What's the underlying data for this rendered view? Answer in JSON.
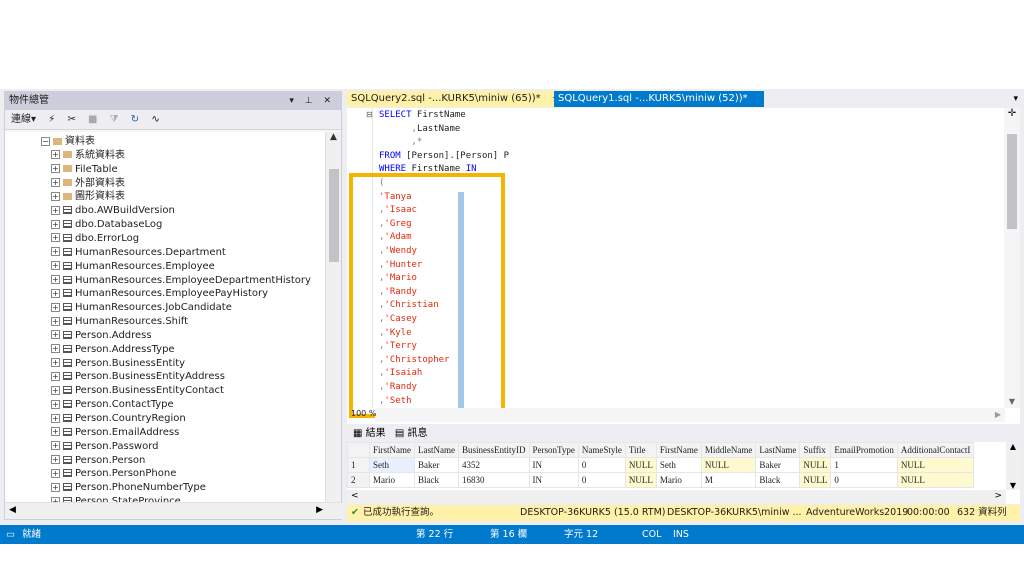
{
  "object_explorer": {
    "title": "物件總管",
    "controls": "▾ ⊥ ✕",
    "toolbar": {
      "connect": "連線▾",
      "icons": [
        "plug-icon",
        "disconnect-icon",
        "stop-icon",
        "filter-icon",
        "refresh-icon",
        "activity-icon"
      ]
    },
    "tree": [
      {
        "label": "資料表",
        "icon": "folder",
        "expand": "−"
      },
      {
        "label": "系統資料表",
        "icon": "folder",
        "expand": "+"
      },
      {
        "label": "FileTable",
        "icon": "folder",
        "expand": "+"
      },
      {
        "label": "外部資料表",
        "icon": "folder",
        "expand": "+"
      },
      {
        "label": "圖形資料表",
        "icon": "folder",
        "expand": "+"
      },
      {
        "label": "dbo.AWBuildVersion",
        "icon": "table",
        "expand": "+"
      },
      {
        "label": "dbo.DatabaseLog",
        "icon": "table",
        "expand": "+"
      },
      {
        "label": "dbo.ErrorLog",
        "icon": "table",
        "expand": "+"
      },
      {
        "label": "HumanResources.Department",
        "icon": "table",
        "expand": "+"
      },
      {
        "label": "HumanResources.Employee",
        "icon": "table",
        "expand": "+"
      },
      {
        "label": "HumanResources.EmployeeDepartmentHistory",
        "icon": "table",
        "expand": "+"
      },
      {
        "label": "HumanResources.EmployeePayHistory",
        "icon": "table",
        "expand": "+"
      },
      {
        "label": "HumanResources.JobCandidate",
        "icon": "table",
        "expand": "+"
      },
      {
        "label": "HumanResources.Shift",
        "icon": "table",
        "expand": "+"
      },
      {
        "label": "Person.Address",
        "icon": "table",
        "expand": "+"
      },
      {
        "label": "Person.AddressType",
        "icon": "table",
        "expand": "+"
      },
      {
        "label": "Person.BusinessEntity",
        "icon": "table",
        "expand": "+"
      },
      {
        "label": "Person.BusinessEntityAddress",
        "icon": "table",
        "expand": "+"
      },
      {
        "label": "Person.BusinessEntityContact",
        "icon": "table",
        "expand": "+"
      },
      {
        "label": "Person.ContactType",
        "icon": "table",
        "expand": "+"
      },
      {
        "label": "Person.CountryRegion",
        "icon": "table",
        "expand": "+"
      },
      {
        "label": "Person.EmailAddress",
        "icon": "table",
        "expand": "+"
      },
      {
        "label": "Person.Password",
        "icon": "table",
        "expand": "+"
      },
      {
        "label": "Person.Person",
        "icon": "table",
        "expand": "+"
      },
      {
        "label": "Person.PersonPhone",
        "icon": "table",
        "expand": "+"
      },
      {
        "label": "Person.PhoneNumberType",
        "icon": "table",
        "expand": "+"
      },
      {
        "label": "Person.StateProvince",
        "icon": "table",
        "expand": "+"
      }
    ]
  },
  "tabs": [
    {
      "label": "SQLQuery2.sql -...KURK5\\miniw (65))*",
      "pin": "⊣",
      "close": "✕"
    },
    {
      "label": "SQLQuery1.sql -...KURK5\\miniw (52))*"
    }
  ],
  "editor": {
    "lines": [
      {
        "parts": [
          [
            "kw",
            "SELECT"
          ],
          [
            "dark",
            " FirstName"
          ]
        ]
      },
      {
        "parts": [
          [
            "gray",
            "      ,"
          ],
          [
            "dark",
            "LastName"
          ]
        ]
      },
      {
        "parts": [
          [
            "gray",
            "      ,*"
          ]
        ]
      },
      {
        "parts": [
          [
            "kw",
            "FROM"
          ],
          [
            "dark",
            " [Person].[Person] P"
          ]
        ]
      },
      {
        "parts": [
          [
            "kw",
            "WHERE"
          ],
          [
            "dark",
            " FirstName "
          ],
          [
            "kw",
            "IN"
          ]
        ]
      },
      {
        "parts": [
          [
            "gray",
            "("
          ]
        ]
      },
      {
        "parts": [
          [
            "str",
            "'Tanya"
          ],
          [
            "str",
            "         '"
          ]
        ]
      },
      {
        "parts": [
          [
            "gray",
            ","
          ],
          [
            "str",
            "'Isaac"
          ],
          [
            "str",
            "        '"
          ]
        ]
      },
      {
        "parts": [
          [
            "gray",
            ","
          ],
          [
            "str",
            "'Greg"
          ],
          [
            "str",
            "         '"
          ]
        ]
      },
      {
        "parts": [
          [
            "gray",
            ","
          ],
          [
            "str",
            "'Adam"
          ],
          [
            "str",
            "         '"
          ]
        ]
      },
      {
        "parts": [
          [
            "gray",
            ","
          ],
          [
            "str",
            "'Wendy"
          ],
          [
            "str",
            "        '"
          ]
        ]
      },
      {
        "parts": [
          [
            "gray",
            ","
          ],
          [
            "str",
            "'Hunter"
          ],
          [
            "str",
            "       '"
          ]
        ]
      },
      {
        "parts": [
          [
            "gray",
            ","
          ],
          [
            "str",
            "'Mario"
          ],
          [
            "str",
            "        '"
          ]
        ]
      },
      {
        "parts": [
          [
            "gray",
            ","
          ],
          [
            "str",
            "'Randy"
          ],
          [
            "str",
            "        '"
          ]
        ]
      },
      {
        "parts": [
          [
            "gray",
            ","
          ],
          [
            "str",
            "'Christian"
          ],
          [
            "str",
            "    '"
          ]
        ]
      },
      {
        "parts": [
          [
            "gray",
            ","
          ],
          [
            "str",
            "'Casey"
          ],
          [
            "str",
            "        '"
          ]
        ]
      },
      {
        "parts": [
          [
            "gray",
            ","
          ],
          [
            "str",
            "'Kyle"
          ],
          [
            "str",
            "         '"
          ]
        ]
      },
      {
        "parts": [
          [
            "gray",
            ","
          ],
          [
            "str",
            "'Terry"
          ],
          [
            "str",
            "        '"
          ]
        ]
      },
      {
        "parts": [
          [
            "gray",
            ","
          ],
          [
            "str",
            "'Christopher"
          ],
          [
            "str",
            "  '"
          ]
        ]
      },
      {
        "parts": [
          [
            "gray",
            ","
          ],
          [
            "str",
            "'Isaiah"
          ],
          [
            "str",
            "       '"
          ]
        ]
      },
      {
        "parts": [
          [
            "gray",
            ","
          ],
          [
            "str",
            "'Randy"
          ],
          [
            "str",
            "        '"
          ]
        ]
      },
      {
        "parts": [
          [
            "gray",
            ","
          ],
          [
            "str",
            "'Seth"
          ],
          [
            "str",
            "         '"
          ]
        ]
      }
    ],
    "fold_marker": "⊟",
    "zoom": "100 %"
  },
  "results": {
    "tab_results": "▦ 結果",
    "tab_messages": "▤ 訊息",
    "columns": [
      "",
      "FirstName",
      "LastName",
      "BusinessEntityID",
      "PersonType",
      "NameStyle",
      "Title",
      "FirstName",
      "MiddleName",
      "LastName",
      "Suffix",
      "EmailPromotion",
      "AdditionalContactI"
    ],
    "rows": [
      [
        "1",
        "Seth",
        "Baker",
        "4352",
        "IN",
        "0",
        "NULL",
        "Seth",
        "NULL",
        "Baker",
        "NULL",
        "1",
        "NULL"
      ],
      [
        "2",
        "Mario",
        "Black",
        "16830",
        "IN",
        "0",
        "NULL",
        "Mario",
        "M",
        "Black",
        "NULL",
        "0",
        "NULL"
      ]
    ]
  },
  "query_status": {
    "message": "已成功執行查詢。",
    "server": "DESKTOP-36KURK5 (15.0 RTM)",
    "user": "DESKTOP-36KURK5\\miniw ...",
    "database": "AdventureWorks2019",
    "elapsed": "00:00:00",
    "rows": "632 資料列"
  },
  "app_status": {
    "ready": "就緒",
    "line": "第 22 行",
    "column": "第 16 欄",
    "char": "字元 12",
    "mode": "COL",
    "insert": "INS"
  },
  "colors": {
    "accent": "#007acc",
    "highlight_box": "#f4b400",
    "tab_active": "#fff1a8",
    "keyword": "#0000ff",
    "string": "#e8260c"
  }
}
